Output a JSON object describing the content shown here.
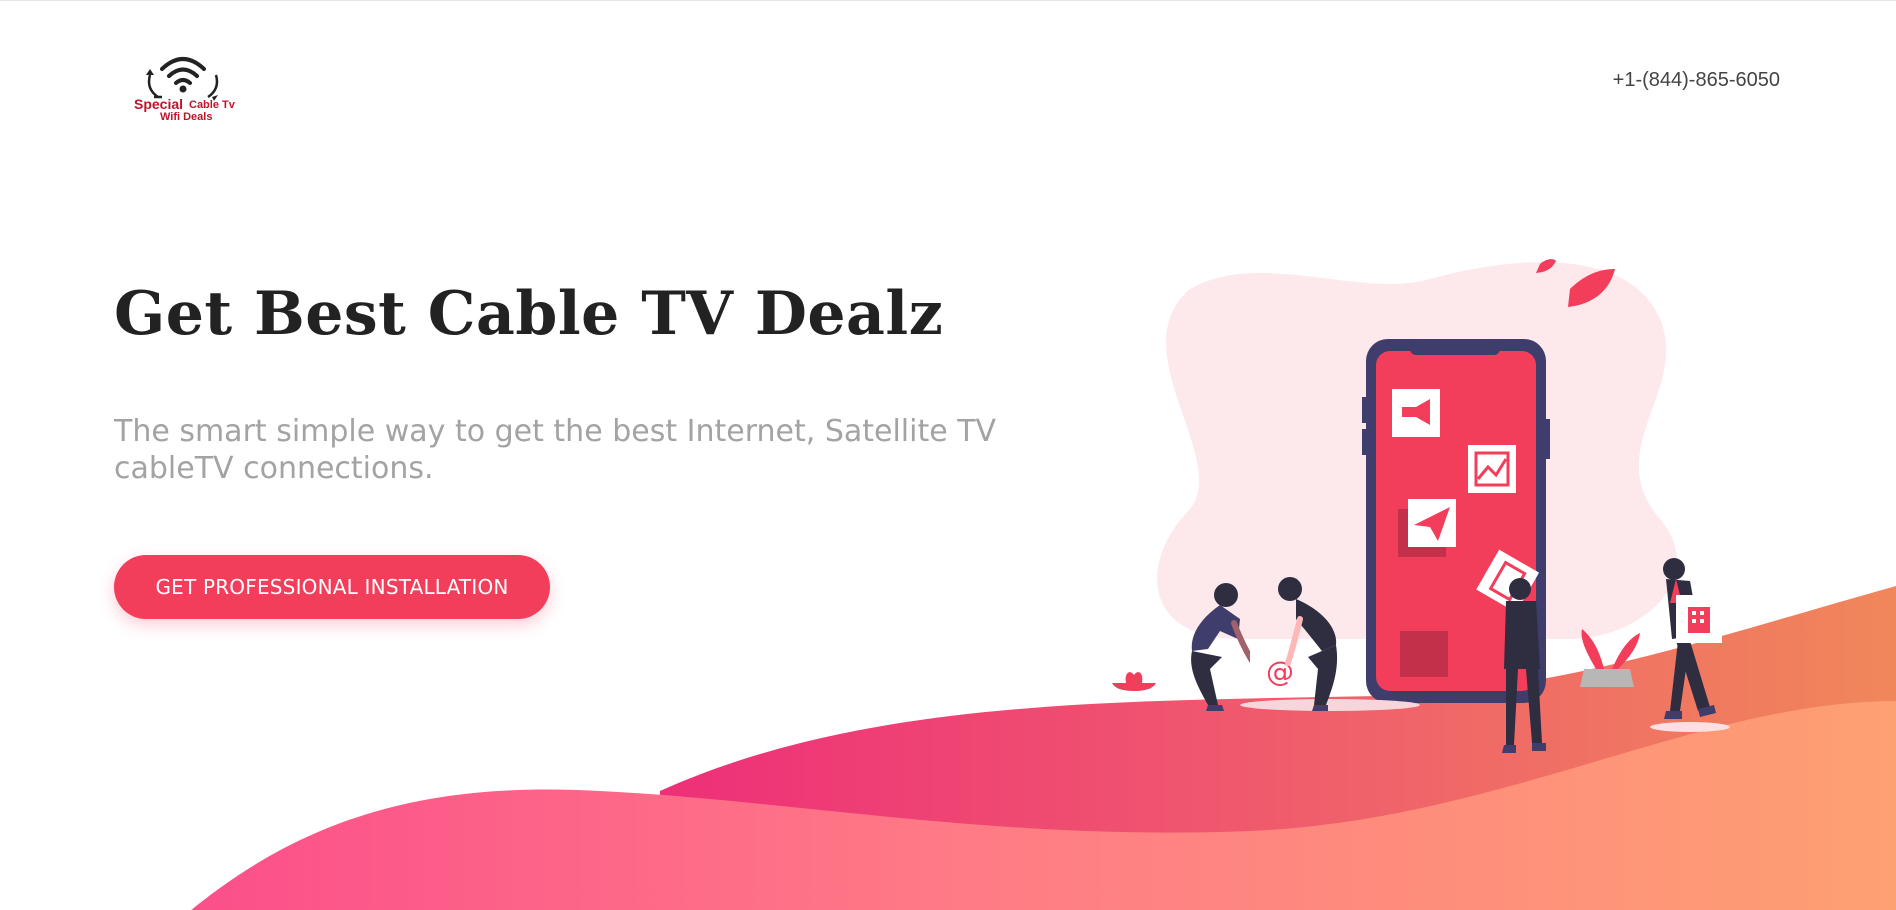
{
  "brand": {
    "line1": "Special",
    "line2": "Cable Tv",
    "line3": "Wifi Deals",
    "color": "#c0132b"
  },
  "header": {
    "phone": "+1-(844)-865-6050"
  },
  "hero": {
    "title": "Get Best Cable TV Dealz",
    "subtitle": "The smart simple way to get the best Internet, Satellite TV cableTV connections.",
    "cta_label": "GET PROFESSIONAL INSTALLATION"
  },
  "colors": {
    "accent": "#f23d5b",
    "title": "#222222",
    "subtitle": "#a3a3a3",
    "wave_start": "#f23d7a",
    "wave_end": "#f6996a",
    "phone_frame": "#3f3d6b"
  },
  "icons": {
    "logo": "wifi-signal-icon",
    "phone_apps": [
      "megaphone-icon",
      "chart-icon",
      "paper-plane-icon",
      "building-icon",
      "at-sign-icon"
    ]
  }
}
